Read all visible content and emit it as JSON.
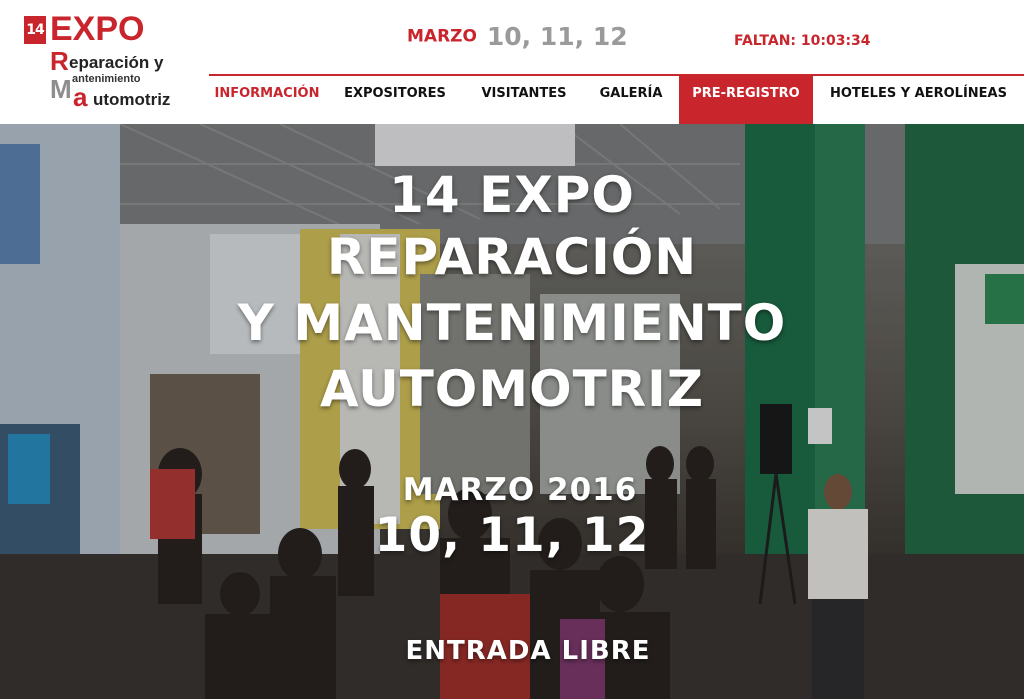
{
  "logo": {
    "badge": "14",
    "expo": "EXPO",
    "letter_r": "R",
    "word_reparacion": "eparación y",
    "letter_m": "M",
    "word_mantenimiento": "antenimiento",
    "letter_a": "a",
    "word_automotriz": "utomotriz"
  },
  "header": {
    "date_label": "MARZO",
    "date_days": "10, 11, 12",
    "countdown": "FALTAN: 10:03:34"
  },
  "nav": {
    "items": [
      {
        "label": "INFORMACIÓN"
      },
      {
        "label": "EXPOSITORES"
      },
      {
        "label": "VISITANTES"
      },
      {
        "label": "GALERÍA"
      },
      {
        "label": "PRE-REGISTRO"
      },
      {
        "label": "HOTELES Y AEROLÍNEAS"
      }
    ]
  },
  "hero": {
    "line1": "14 EXPO",
    "line2": "REPARACIÓN",
    "line3": "Y MANTENIMIENTO",
    "line4": "AUTOMOTRIZ",
    "month_year": "MARZO 2016",
    "days": "10, 11, 12",
    "entry": "ENTRADA LIBRE"
  },
  "colors": {
    "brand_red": "#c9252c",
    "date_gray": "#9a9a9a"
  }
}
